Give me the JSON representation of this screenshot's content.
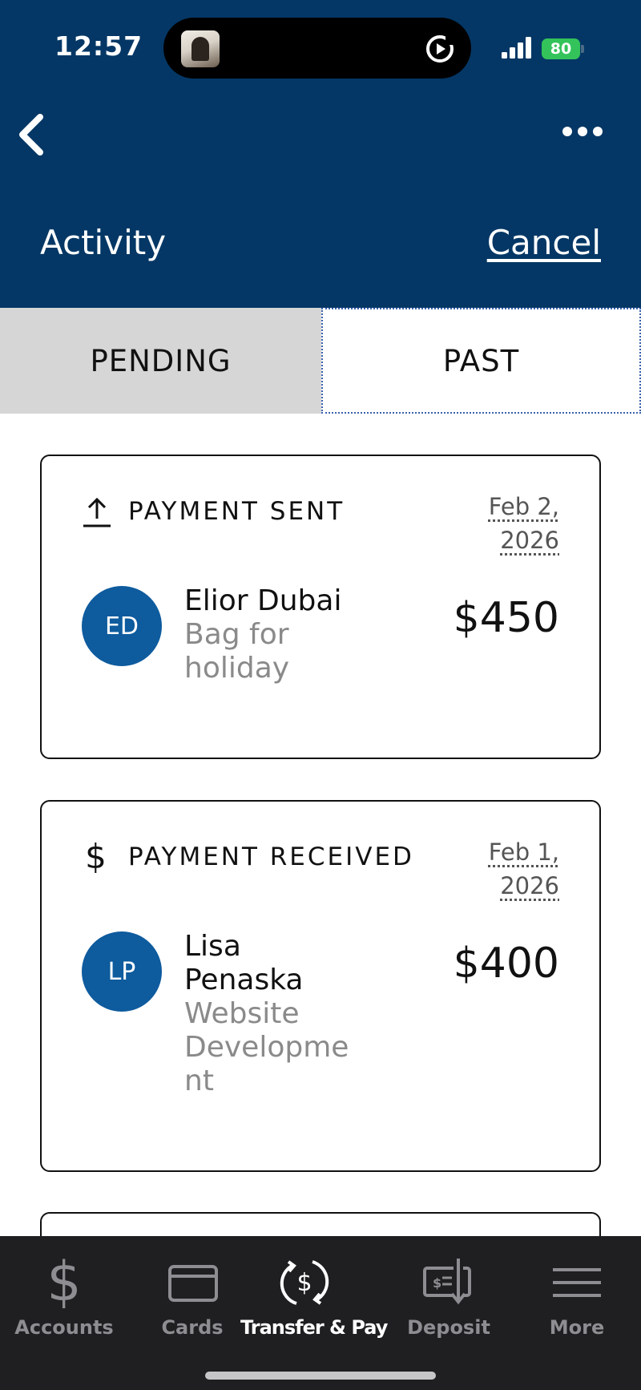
{
  "status_bar": {
    "time": "12:57",
    "battery": "80"
  },
  "header": {
    "title": "Activity",
    "cancel_label": "Cancel"
  },
  "tabs": [
    {
      "label": "PENDING",
      "selected": false
    },
    {
      "label": "PAST",
      "selected": true
    }
  ],
  "activity": [
    {
      "type_label": "PAYMENT SENT",
      "type_icon": "upload-arrow-icon",
      "date_line1": "Feb 2,",
      "date_line2": "2026",
      "initials": "ED",
      "name": "Elior Dubai",
      "memo_line1": "Bag for",
      "memo_line2": "holiday",
      "amount": "$450"
    },
    {
      "type_label": "PAYMENT RECEIVED",
      "type_icon": "dollar-icon",
      "date_line1": "Feb 1,",
      "date_line2": "2026",
      "initials": "LP",
      "name_line1": "Lisa",
      "name_line2": "Penaska",
      "memo_line1": "Website",
      "memo_line2": "Developme",
      "memo_line3": "nt",
      "amount": "$400"
    }
  ],
  "bottom_nav": [
    {
      "label": "Accounts",
      "icon": "dollar-icon",
      "active": false
    },
    {
      "label": "Cards",
      "icon": "card-icon",
      "active": false
    },
    {
      "label": "Transfer & Pay",
      "icon": "transfer-pay-icon",
      "active": true
    },
    {
      "label": "Deposit",
      "icon": "check-deposit-icon",
      "active": false
    },
    {
      "label": "More",
      "icon": "menu-icon",
      "active": false
    }
  ],
  "colors": {
    "header_bg": "#043765",
    "avatar_bg": "#0e5b9e",
    "nav_bg": "#1f1f21",
    "tab_inactive_bg": "#d6d6d6",
    "battery_green": "#33c35a"
  }
}
